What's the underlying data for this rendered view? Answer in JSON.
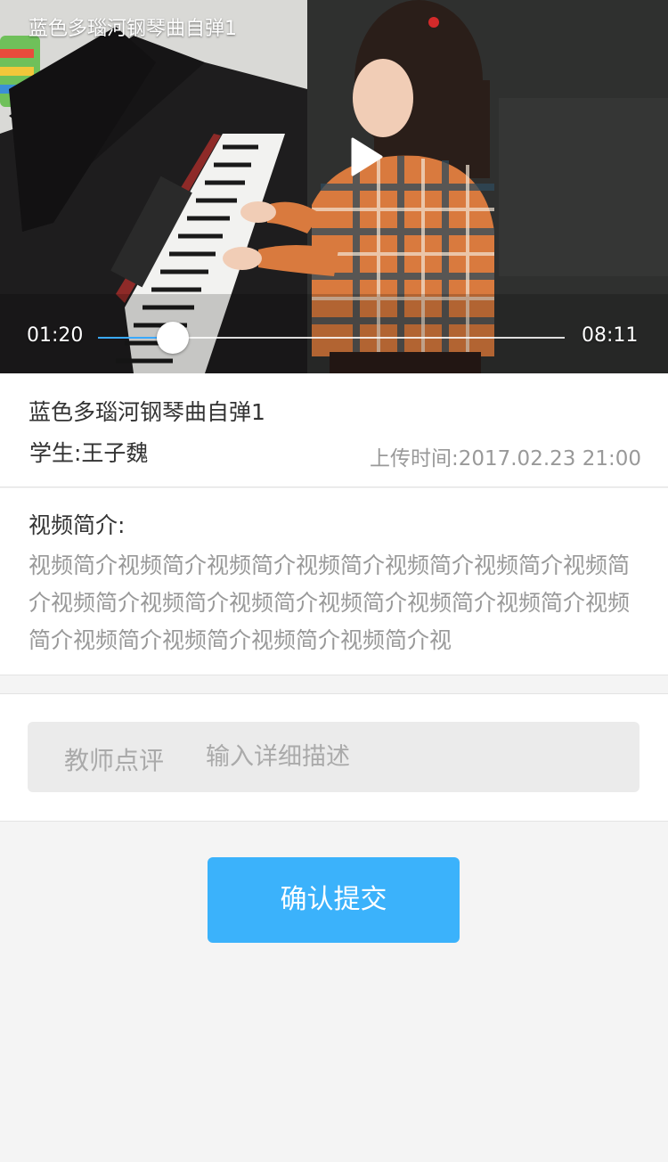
{
  "player": {
    "title": "蓝色多瑙河钢琴曲自弹1",
    "current_time": "01:20",
    "total_time": "08:11",
    "progress_fraction": 0.16,
    "accent_color": "#3aa9ff",
    "play_icon": "play-icon"
  },
  "info": {
    "title": "蓝色多瑙河钢琴曲自弹1",
    "student": "学生:王子魏",
    "upload_time": "上传时间:2017.02.23  21:00"
  },
  "intro": {
    "label": "视频简介:",
    "text": "视频简介视频简介视频简介视频简介视频简介视频简介视频简介视频简介视频简介视频简介视频简介视频简介视频简介视频简介视频简介视频简介视频简介视频简介视"
  },
  "comment": {
    "label": "教师点评",
    "placeholder": "输入详细描述",
    "value": ""
  },
  "submit": {
    "label": "确认提交",
    "color": "#3bb2fb"
  }
}
